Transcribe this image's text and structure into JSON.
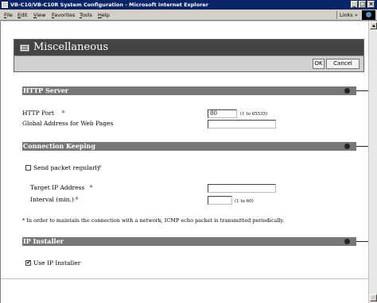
{
  "window": {
    "title": "VB-C10/VB-C10R System Configuration - Microsoft Internet Explorer",
    "minimize_glyph": "_",
    "maximize_glyph": "□",
    "close_glyph": "×"
  },
  "menu": {
    "items": [
      "File",
      "Edit",
      "View",
      "Favorites",
      "Tools",
      "Help"
    ],
    "links_label": "Links »"
  },
  "page": {
    "title": "Miscellaneous",
    "ok_label": "OK",
    "cancel_label": "Cancel"
  },
  "http_server": {
    "heading": "HTTP Server",
    "http_port_label": "HTTP Port",
    "http_port_value": "80",
    "http_port_range": "(1 to 65535)",
    "global_address_label": "Global Address for Web Pages",
    "global_address_value": ""
  },
  "connection_keeping": {
    "heading": "Connection Keeping",
    "send_packet_label": "Send packet regularly",
    "send_packet_checked": false,
    "target_ip_label": "Target IP Address",
    "target_ip_value": "",
    "interval_label": "Interval (min.)",
    "interval_value": "",
    "interval_range": "(1 to 60)",
    "note": "* In order to maintain the connection with a network, ICMP echo packet is transmitted periodically."
  },
  "ip_installer": {
    "heading": "IP Installer",
    "use_label": "Use IP Installer",
    "use_checked": true
  },
  "colors": {
    "title_bar": "#0a246a",
    "header_bg": "#444444",
    "section_bg": "#777777"
  }
}
